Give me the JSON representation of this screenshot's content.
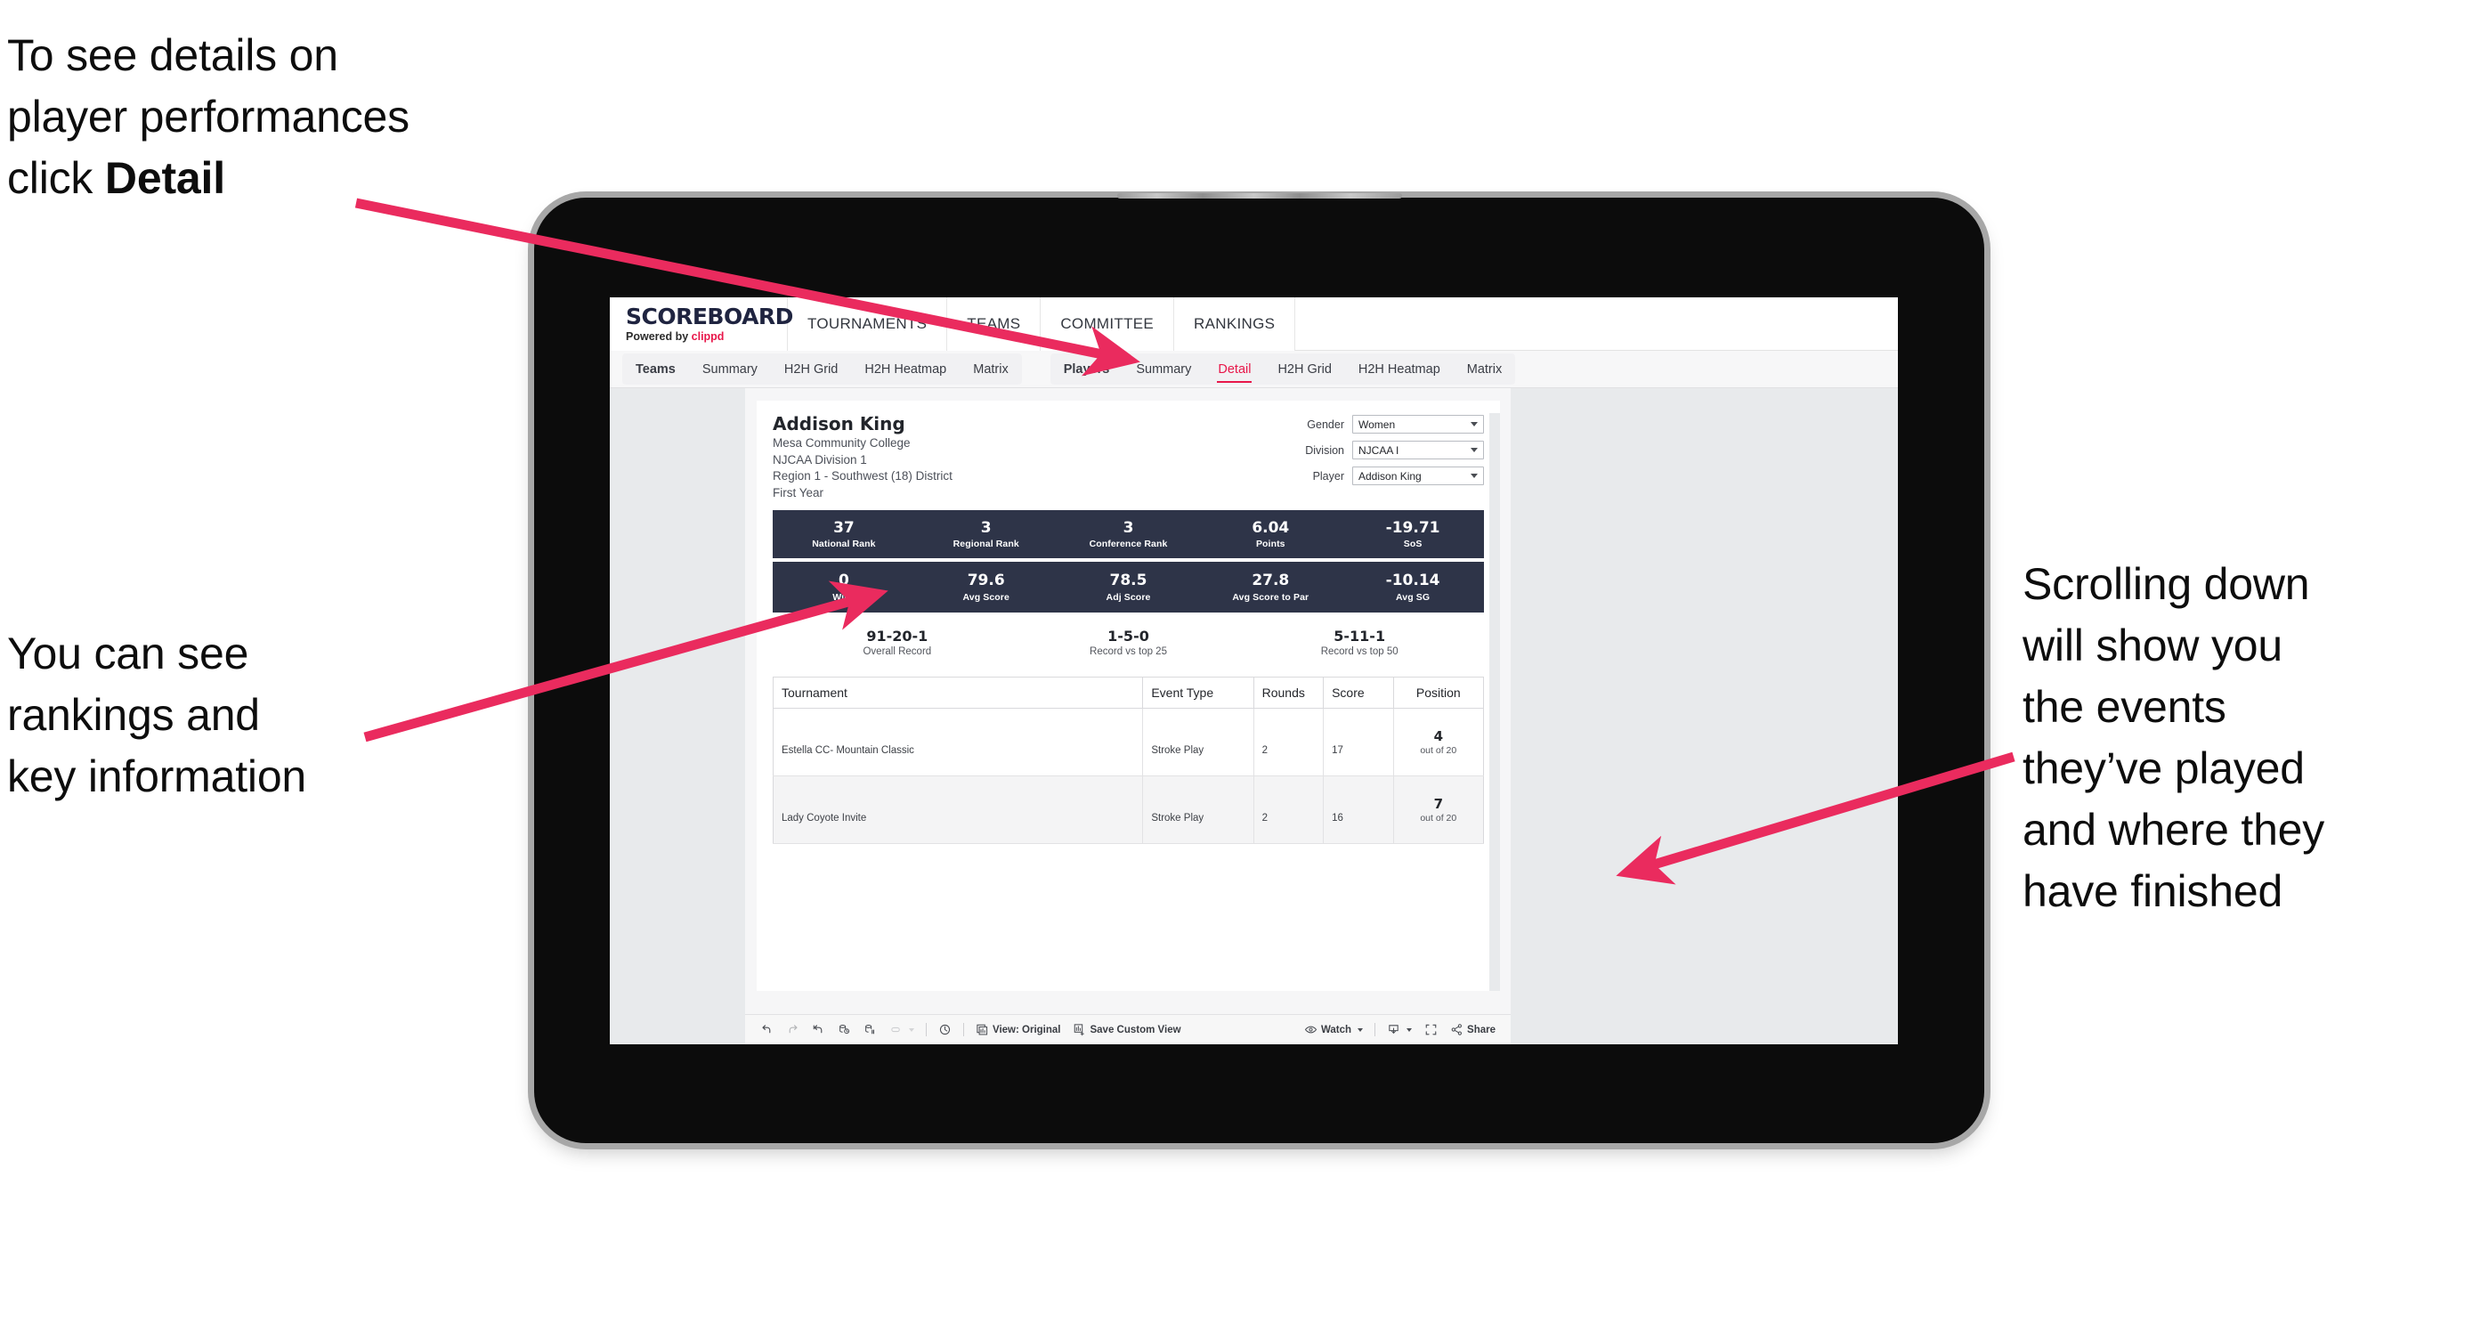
{
  "annotations": {
    "detail": {
      "line1": "To see details on",
      "line2": "player performances",
      "line3_prefix": "click ",
      "line3_bold": "Detail"
    },
    "rankings": {
      "line1": "You can see",
      "line2": "rankings and",
      "line3": "key information"
    },
    "scroll": {
      "line1": "Scrolling down",
      "line2": "will show you",
      "line3": "the events",
      "line4": "they’ve played",
      "line5": "and where they",
      "line6": "have finished"
    },
    "arrow_color": "#ea2b5e"
  },
  "app": {
    "brand": {
      "title": "SCOREBOARD",
      "powered_prefix": "Powered by ",
      "powered_name": "clippd"
    },
    "topnav": [
      "TOURNAMENTS",
      "TEAMS",
      "COMMITTEE",
      "RANKINGS"
    ],
    "subnav": {
      "group1": [
        "Teams",
        "Summary",
        "H2H Grid",
        "H2H Heatmap",
        "Matrix"
      ],
      "group2": [
        "Players",
        "Summary",
        "Detail",
        "H2H Grid",
        "H2H Heatmap",
        "Matrix"
      ],
      "active": "Detail"
    }
  },
  "player": {
    "name": "Addison King",
    "school": "Mesa Community College",
    "division": "NJCAA Division 1",
    "region": "Region 1 - Southwest (18) District",
    "year": "First Year"
  },
  "filters": [
    {
      "label": "Gender",
      "value": "Women"
    },
    {
      "label": "Division",
      "value": "NJCAA I"
    },
    {
      "label": "Player",
      "value": "Addison King"
    }
  ],
  "stats_row1": [
    {
      "value": "37",
      "label": "National Rank"
    },
    {
      "value": "3",
      "label": "Regional Rank"
    },
    {
      "value": "3",
      "label": "Conference Rank"
    },
    {
      "value": "6.04",
      "label": "Points"
    },
    {
      "value": "-19.71",
      "label": "SoS"
    }
  ],
  "stats_row2": [
    {
      "value": "0",
      "label": "Wins"
    },
    {
      "value": "79.6",
      "label": "Avg Score"
    },
    {
      "value": "78.5",
      "label": "Adj Score"
    },
    {
      "value": "27.8",
      "label": "Avg Score to Par"
    },
    {
      "value": "-10.14",
      "label": "Avg SG"
    }
  ],
  "records": [
    {
      "value": "91-20-1",
      "label": "Overall Record"
    },
    {
      "value": "1-5-0",
      "label": "Record vs top 25"
    },
    {
      "value": "5-11-1",
      "label": "Record vs top 50"
    }
  ],
  "events_table": {
    "columns": [
      "Tournament",
      "Event Type",
      "Rounds",
      "Score",
      "Position"
    ],
    "rows": [
      {
        "tournament": "Estella CC- Mountain Classic",
        "event_type": "Stroke Play",
        "rounds": "2",
        "score": "17",
        "position": "4",
        "position_sub": "out of 20"
      },
      {
        "tournament": "Lady Coyote Invite",
        "event_type": "Stroke Play",
        "rounds": "2",
        "score": "16",
        "position": "7",
        "position_sub": "out of 20"
      }
    ]
  },
  "bottom_toolbar": {
    "view_label": "View: Original",
    "save_label": "Save Custom View",
    "watch_label": "Watch",
    "share_label": "Share"
  },
  "colors": {
    "accent": "#e8174a",
    "statbar": "#2e3448",
    "arrow": "#ea2b5e"
  }
}
